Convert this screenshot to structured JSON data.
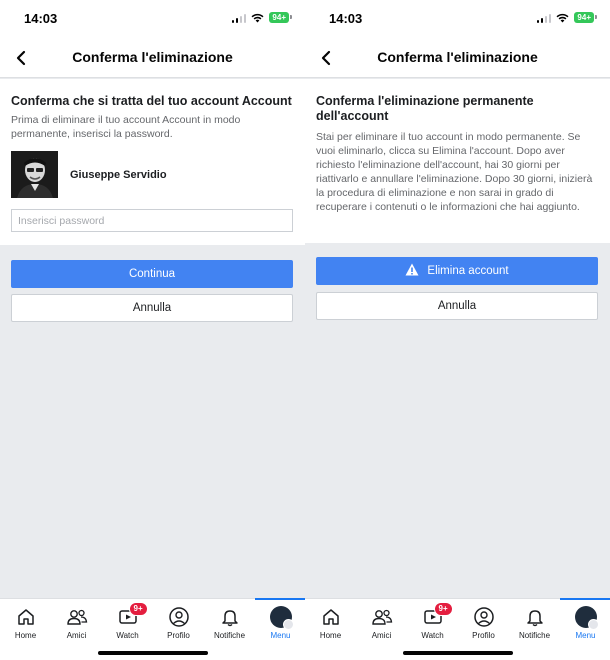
{
  "screens": [
    {
      "status_time": "14:03",
      "battery": "94+",
      "title": "Conferma l'eliminazione",
      "card_title": "Conferma che si tratta del tuo account Account",
      "card_text": "Prima di eliminare il tuo account Account in modo permanente, inserisci la password.",
      "profile_name": "Giuseppe Servidio",
      "password_placeholder": "Inserisci password",
      "primary_button": "Continua",
      "secondary_button": "Annulla"
    },
    {
      "status_time": "14:03",
      "battery": "94+",
      "title": "Conferma l'eliminazione",
      "card_title": "Conferma l'eliminazione permanente dell'account",
      "card_text": "Stai per eliminare il tuo account in modo permanente. Se vuoi eliminarlo, clicca su Elimina l'account. Dopo aver richiesto l'eliminazione dell'account, hai 30 giorni per riattivarlo e annullare l'eliminazione. Dopo 30 giorni, inizierà la procedura di eliminazione e non sarai in grado di recuperare i contenuti o le informazioni che hai aggiunto.",
      "primary_button": "Elimina account",
      "primary_button_icon": "warning-icon",
      "secondary_button": "Annulla"
    }
  ],
  "tab_bar": {
    "tabs": [
      {
        "label": "Home",
        "icon": "home-icon"
      },
      {
        "label": "Amici",
        "icon": "friends-icon"
      },
      {
        "label": "Watch",
        "icon": "watch-icon",
        "badge": "9+"
      },
      {
        "label": "Profilo",
        "icon": "profile-icon"
      },
      {
        "label": "Notifiche",
        "icon": "bell-icon"
      },
      {
        "label": "Menu",
        "icon": "menu-avatar-icon",
        "active": true
      }
    ]
  },
  "colors": {
    "primary_button": "#4283f2",
    "active_tab": "#1877f2",
    "badge": "#e41e3f",
    "battery": "#34c759",
    "background": "#e9ebee"
  }
}
